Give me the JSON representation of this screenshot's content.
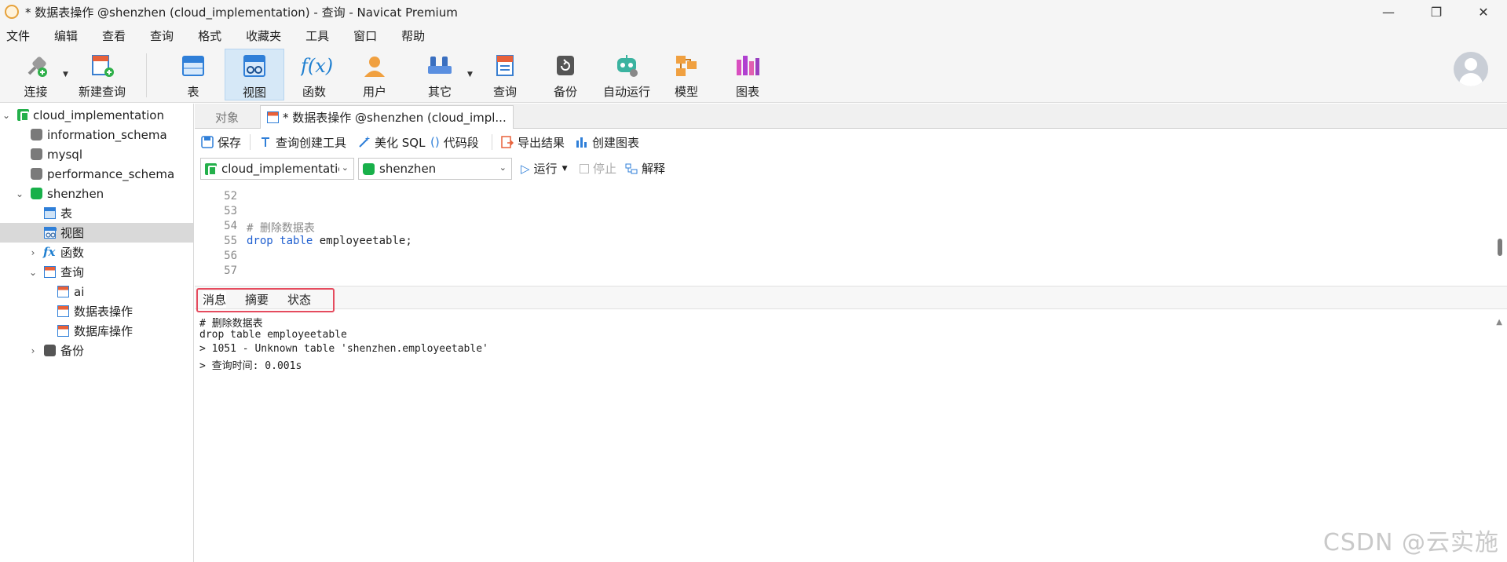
{
  "window": {
    "title": "* 数据表操作 @shenzhen (cloud_implementation) - 查询 - Navicat Premium",
    "minimize": "—",
    "maximize": "❐",
    "close": "✕"
  },
  "menu": [
    "文件",
    "编辑",
    "查看",
    "查询",
    "格式",
    "收藏夹",
    "工具",
    "窗口",
    "帮助"
  ],
  "toolbar": {
    "connect": "连接",
    "new_query": "新建查询",
    "table": "表",
    "view": "视图",
    "function": "函数",
    "user": "用户",
    "other": "其它",
    "query": "查询",
    "backup": "备份",
    "auto_run": "自动运行",
    "model": "模型",
    "chart": "图表",
    "function_glyph": "f(x)"
  },
  "sidebar": {
    "connection": "cloud_implementation",
    "databases": [
      "information_schema",
      "mysql",
      "performance_schema"
    ],
    "active_db": "shenzhen",
    "nodes": {
      "tables": "表",
      "views": "视图",
      "functions": "函数",
      "queries": "查询",
      "backups": "备份"
    },
    "queries": [
      "ai",
      "数据表操作",
      "数据库操作"
    ],
    "function_glyph": "fx"
  },
  "tabs": {
    "objects": "对象",
    "query_tab": "* 数据表操作 @shenzhen (cloud_impl..."
  },
  "query_toolbar": {
    "save": "保存",
    "query_builder": "查询创建工具",
    "beautify": "美化 SQL",
    "snippet": "代码段",
    "export": "导出结果",
    "create_chart": "创建图表",
    "snippet_glyph": "()"
  },
  "selectors": {
    "connection": "cloud_implementation",
    "database": "shenzhen",
    "run": "运行",
    "stop": "停止",
    "explain": "解释"
  },
  "editor": {
    "line_numbers": [
      "52",
      "53",
      "54",
      "55",
      "56",
      "57"
    ],
    "comment": "# 删除数据表",
    "kw_drop": "drop",
    "kw_table": "table",
    "stmt_rest": " employeetable;"
  },
  "result_tabs": [
    "消息",
    "摘要",
    "状态"
  ],
  "output": [
    "# 删除数据表",
    "drop table employeetable",
    "> 1051 - Unknown table 'shenzhen.employeetable'",
    "> 查询时间: 0.001s"
  ],
  "watermark": "CSDN @云实施"
}
